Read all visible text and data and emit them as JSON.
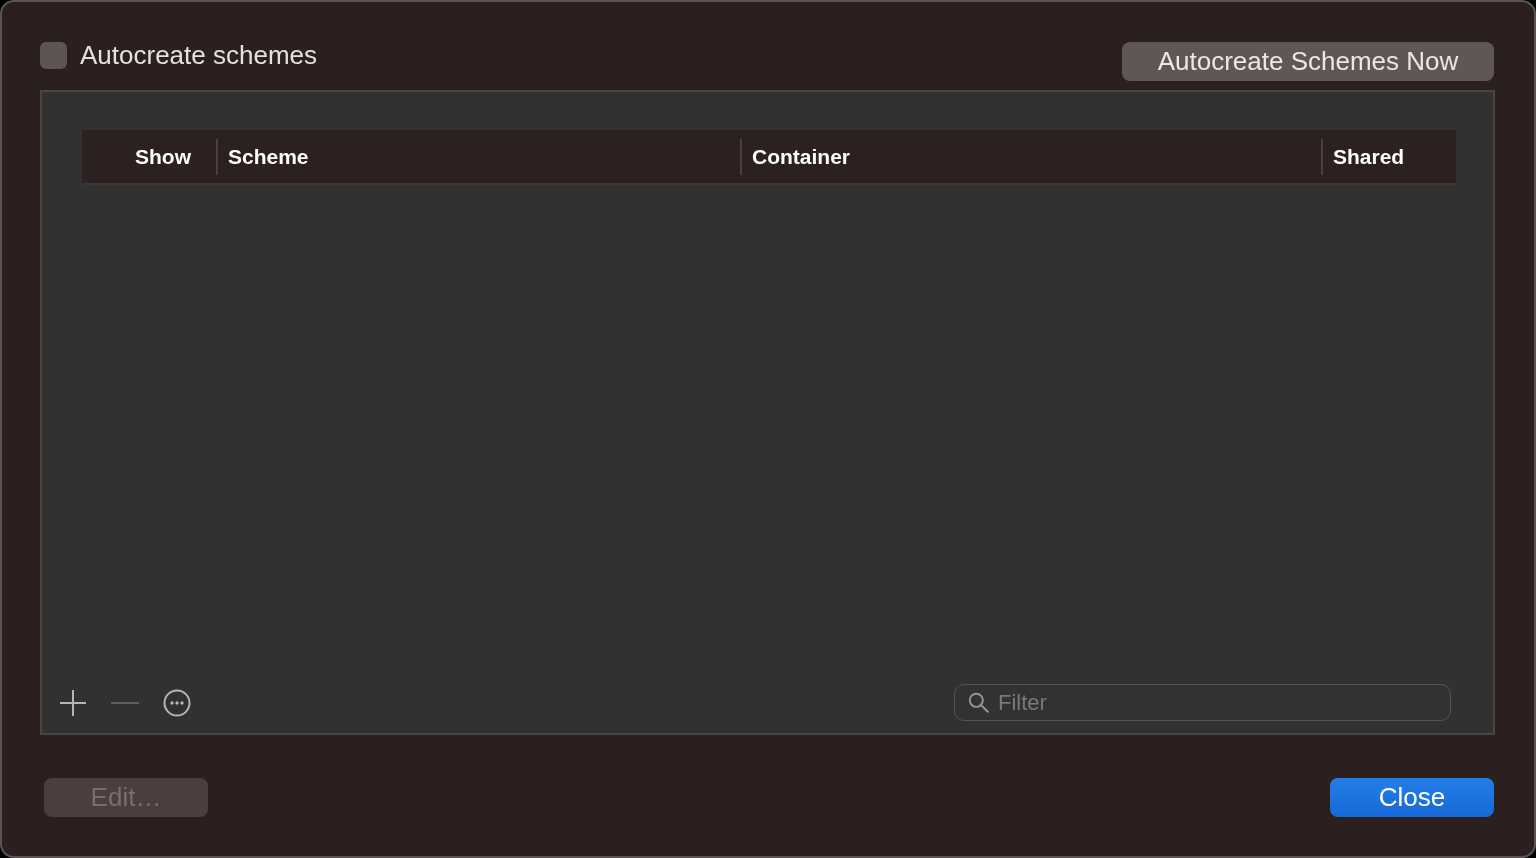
{
  "autocreate": {
    "label": "Autocreate schemes",
    "checked": false
  },
  "autocreate_now_button": {
    "label": "Autocreate Schemes Now"
  },
  "table": {
    "columns": [
      "Show",
      "Scheme",
      "Container",
      "Shared"
    ]
  },
  "toolbar": {
    "buttons": [
      {
        "kind": "add",
        "disabled": false
      },
      {
        "kind": "remove",
        "disabled": true
      },
      {
        "kind": "more",
        "disabled": false
      }
    ]
  },
  "filter": {
    "placeholder": "Filter"
  },
  "footer": {
    "buttons": [
      {
        "label": "Edit…",
        "kind": "secondary",
        "disabled": true
      },
      {
        "label": "Close",
        "kind": "primary",
        "disabled": false
      }
    ]
  }
}
